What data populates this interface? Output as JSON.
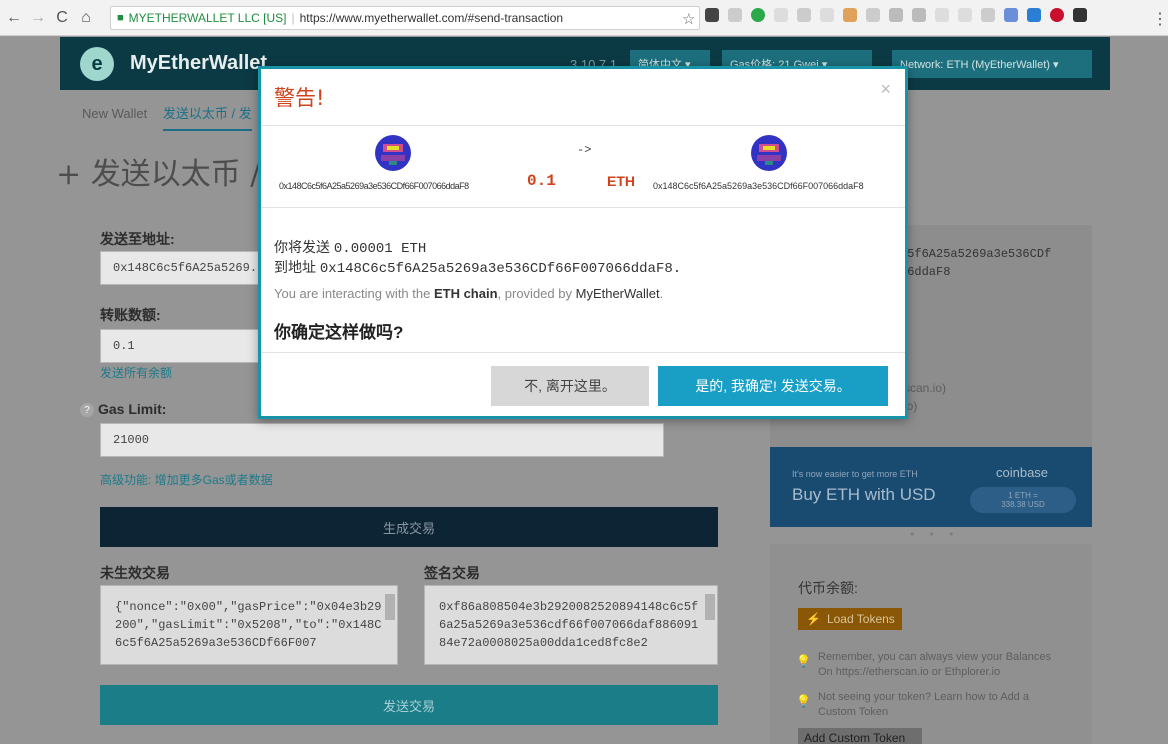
{
  "browser": {
    "site_identity": "MYETHERWALLET LLC [US]",
    "url": "https://www.myetherwallet.com/#send-transaction"
  },
  "header": {
    "brand": "MyEtherWallet",
    "version": "3.10.7.1",
    "language": "简体中文 ▾",
    "gas_price": "Gas价格: 21 Gwei ▾",
    "network": "Network: ETH (MyEtherWallet) ▾"
  },
  "tabs": {
    "new_wallet": "New Wallet",
    "send": "发送以太币 / 发"
  },
  "page_title": "发送以太币 /",
  "form": {
    "to_label": "发送至地址:",
    "to_value": "0x148C6c5f6A25a5269.",
    "amount_label": "转账数额:",
    "amount_value": "0.1",
    "send_all": "发送所有余额",
    "gas_label": "Gas Limit:",
    "gas_value": "21000",
    "advanced": "高级功能: 增加更多Gas或者数据",
    "generate_btn": "生成交易",
    "raw_label": "未生效交易",
    "signed_label": "签名交易",
    "raw_value": "{\"nonce\":\"0x00\",\"gasPrice\":\"0x04e3b29200\",\"gasLimit\":\"0x5208\",\"to\":\"0x148C6c5f6A25a5269a3e536CDf66F007",
    "signed_value": "0xf86a808504e3b2920082520894148c6c5f6a25a5269a3e536cdf66f007066daf88609184e72a0008025a00dda1ced8fc8e2",
    "send_btn": "发送交易"
  },
  "sidebar": {
    "addr_line1": ":5f6A25a5269a3e536CDf",
    "addr_line2": "56ddaF8",
    "link_line1": "scan.io)",
    "link_line2": "io)",
    "coinbase_small": "It's now easier to get more ETH",
    "coinbase_big": "Buy ETH with USD",
    "coinbase_logo": "coinbase",
    "coinbase_rate1": "1 ETH =",
    "coinbase_rate2": "338.38 USD",
    "dots": "• • •",
    "token_title": "代币余额:",
    "load_tokens": "Load Tokens",
    "remember1": "Remember, you can always view your Balances",
    "remember2": "On https://etherscan.io or Ethplorer.io",
    "notseeing1": "Not seeing your token? Learn how to Add a",
    "notseeing2": "Custom Token",
    "add_custom": "Add Custom Token"
  },
  "modal": {
    "title": "警告!",
    "close": "×",
    "arrow": "->",
    "from_addr": "0x148C6c5f6A25a5269a3e536CDf66F007066ddaF8",
    "amount": "0.1",
    "unit": "ETH",
    "to_addr": "0x148C6c5f6A25a5269a3e536CDf66F007066ddaF8",
    "send_prefix": "你将发送",
    "send_value": "0.00001 ETH",
    "to_prefix": "到地址",
    "to_value": "0x148C6c5f6A25a5269a3e536CDf66F007066ddaF8.",
    "interact_1": "You are interacting with the",
    "interact_chain": "ETH chain",
    "interact_2": ", provided by",
    "interact_provider": "MyEtherWallet",
    "interact_end": ".",
    "question": "你确定这样做吗?",
    "no_btn": "不, 离开这里。",
    "yes_btn": "是的, 我确定! 发送交易。"
  }
}
